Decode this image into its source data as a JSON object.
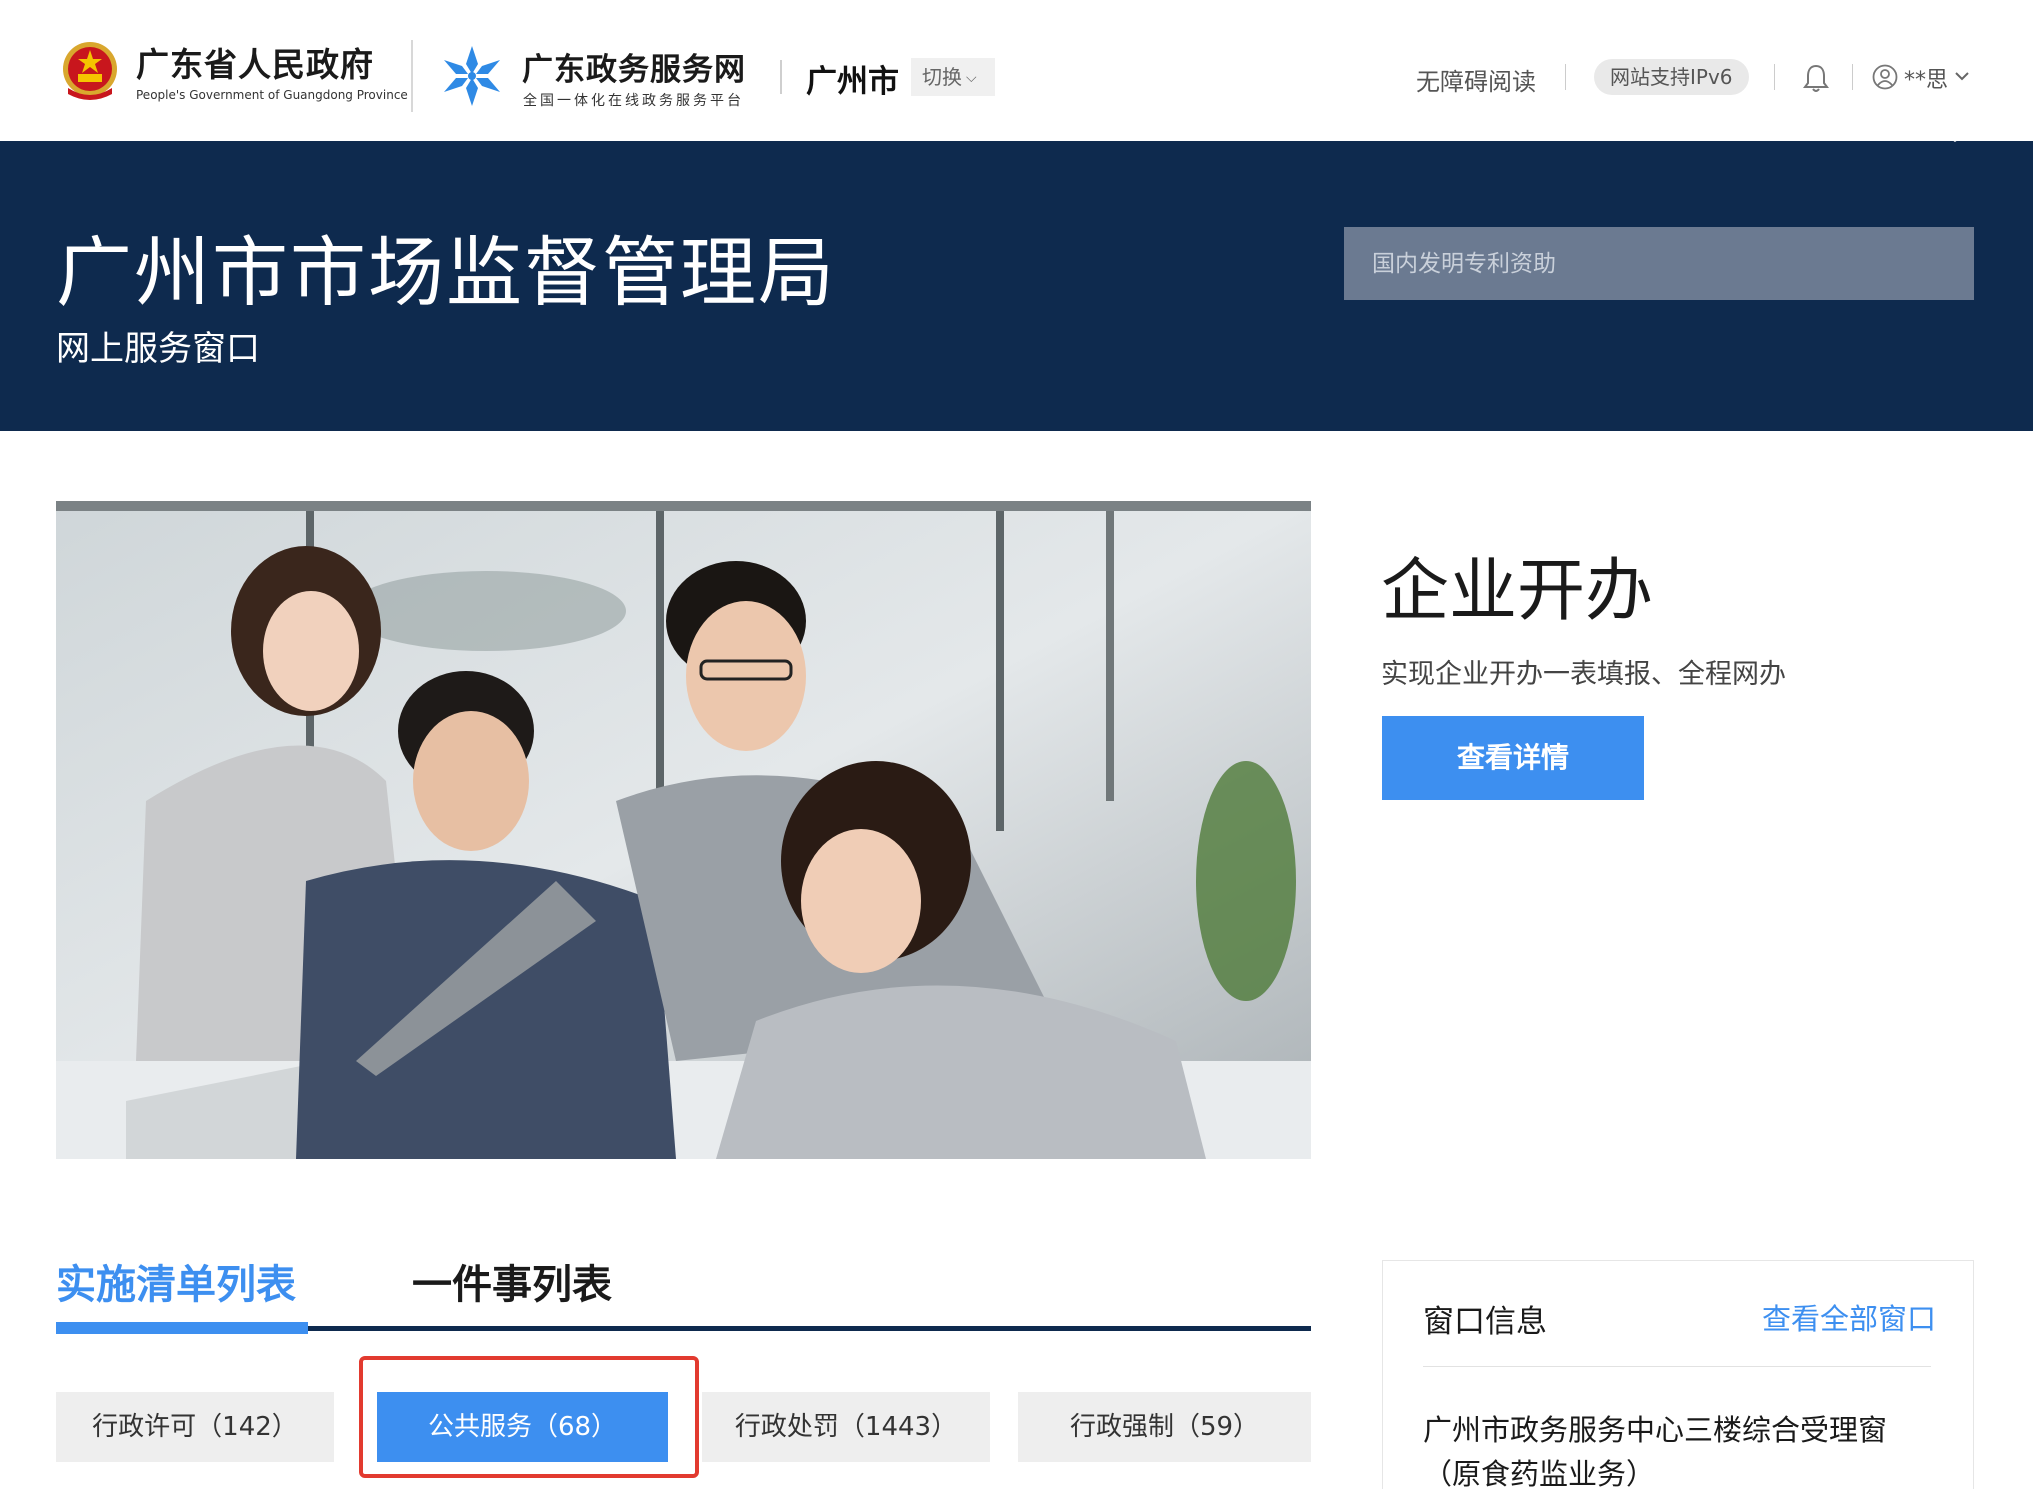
{
  "header": {
    "gov_title": "广东省人民政府",
    "gov_subtitle": "People's Government of Guangdong Province",
    "service_title": "广东政务服务网",
    "service_subtitle": "全国一体化在线政务服务平台",
    "city": "广州市",
    "switch_label": "切换",
    "accessibility_label": "无障碍阅读",
    "ipv6_label": "网站支持IPv6",
    "user_name": "**思",
    "icons": {
      "emblem": "national-emblem-icon",
      "service_logo": "snowflake-logo-icon",
      "bell": "bell-icon",
      "user": "user-circle-icon",
      "chevron": "chevron-down-icon"
    }
  },
  "banner": {
    "title": "广州市市场监督管理局",
    "subtitle": "网上服务窗口",
    "search": {
      "placeholder": "国内发明专利资助",
      "icon": "search-icon"
    }
  },
  "feature": {
    "title": "企业开办",
    "description": "实现企业开办一表填报、全程网办",
    "button_label": "查看详情"
  },
  "tabs": [
    {
      "label": "实施清单列表",
      "active": true
    },
    {
      "label": "一件事列表",
      "active": false
    }
  ],
  "categories": [
    {
      "label": "行政许可（142）",
      "selected": false
    },
    {
      "label": "公共服务（68）",
      "selected": true
    },
    {
      "label": "行政处罚（1443）",
      "selected": false
    },
    {
      "label": "行政强制（59）",
      "selected": false
    }
  ],
  "window_info": {
    "title": "窗口信息",
    "view_all_label": "查看全部窗口",
    "items": [
      {
        "label": "广州市政务服务中心三楼综合受理窗（原食药监业务）"
      }
    ]
  },
  "colors": {
    "banner_bg": "#0e2a4e",
    "accent_blue": "#3d8ff0",
    "highlight_red": "#e23a2f"
  }
}
